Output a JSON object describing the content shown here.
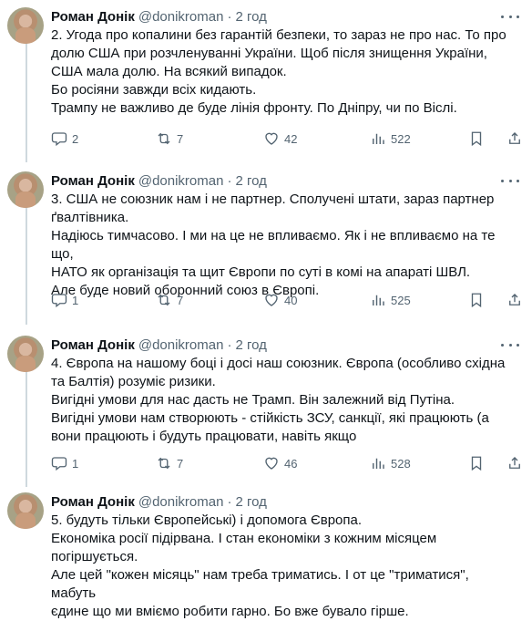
{
  "author": {
    "name": "Роман Донік",
    "handle": "@donikroman",
    "separator": "·"
  },
  "tweets": [
    {
      "time": "2 год",
      "lines": [
        "2. Угода про копалини без гарантій безпеки, то зараз не про нас. То про",
        "долю США при розчленуванні України. Щоб після знищення України,",
        "США мала долю. На всякий випадок.",
        "Бо росіяни завжди всіх кидають.",
        "Трампу не важливо де буде лінія фронту. По Дніпру, чи по Віслі."
      ],
      "replies": "2",
      "reposts": "7",
      "likes": "42",
      "views": "522"
    },
    {
      "time": "2 год",
      "lines": [
        "3. США не союзник нам і не партнер. Сполучені штати, зараз партнер",
        "ґвалтівника.",
        "Надіюсь тимчасово. І ми на це не впливаємо. Як і не впливаємо на те що,",
        "НАТО як організація та щит Європи по суті в комі на апараті ШВЛ.",
        "Але буде новий оборонний союз в Європі."
      ],
      "replies": "1",
      "reposts": "7",
      "likes": "40",
      "views": "525"
    },
    {
      "time": "2 год",
      "lines": [
        "4. Європа на нашому боці і досі наш союзник. Європа (особливо східна",
        "та Балтія) розуміє ризики.",
        "Вигідні умови для нас дасть не Трамп. Він залежний від Путіна.",
        "Вигідні умови нам створюють - стійкість ЗСУ, санкції, які працюють (а",
        "вони працюють і будуть працювати, навіть якщо"
      ],
      "replies": "1",
      "reposts": "7",
      "likes": "46",
      "views": "528"
    },
    {
      "time": "2 год",
      "lines": [
        "5. будуть тільки Європейські) і допомога Європа.",
        "Економіка росії підірвана. І стан економіки з кожним місяцем",
        "погіршується.",
        "Але цей \"кожен місяць\" нам треба триматись. І от це \"триматися\", мабуть",
        "єдине що ми вміємо робити гарно. Бо вже бувало гірше."
      ]
    }
  ],
  "icons": {
    "reply": "speech-bubble-icon",
    "repost": "repost-arrows-icon",
    "like": "heart-icon",
    "views": "bar-chart-icon",
    "bookmark": "bookmark-icon",
    "share": "share-upload-icon",
    "more": "more-dots-icon"
  },
  "colors": {
    "text": "#0f1419",
    "secondary": "#536471",
    "thread_line": "#cfd9de"
  }
}
